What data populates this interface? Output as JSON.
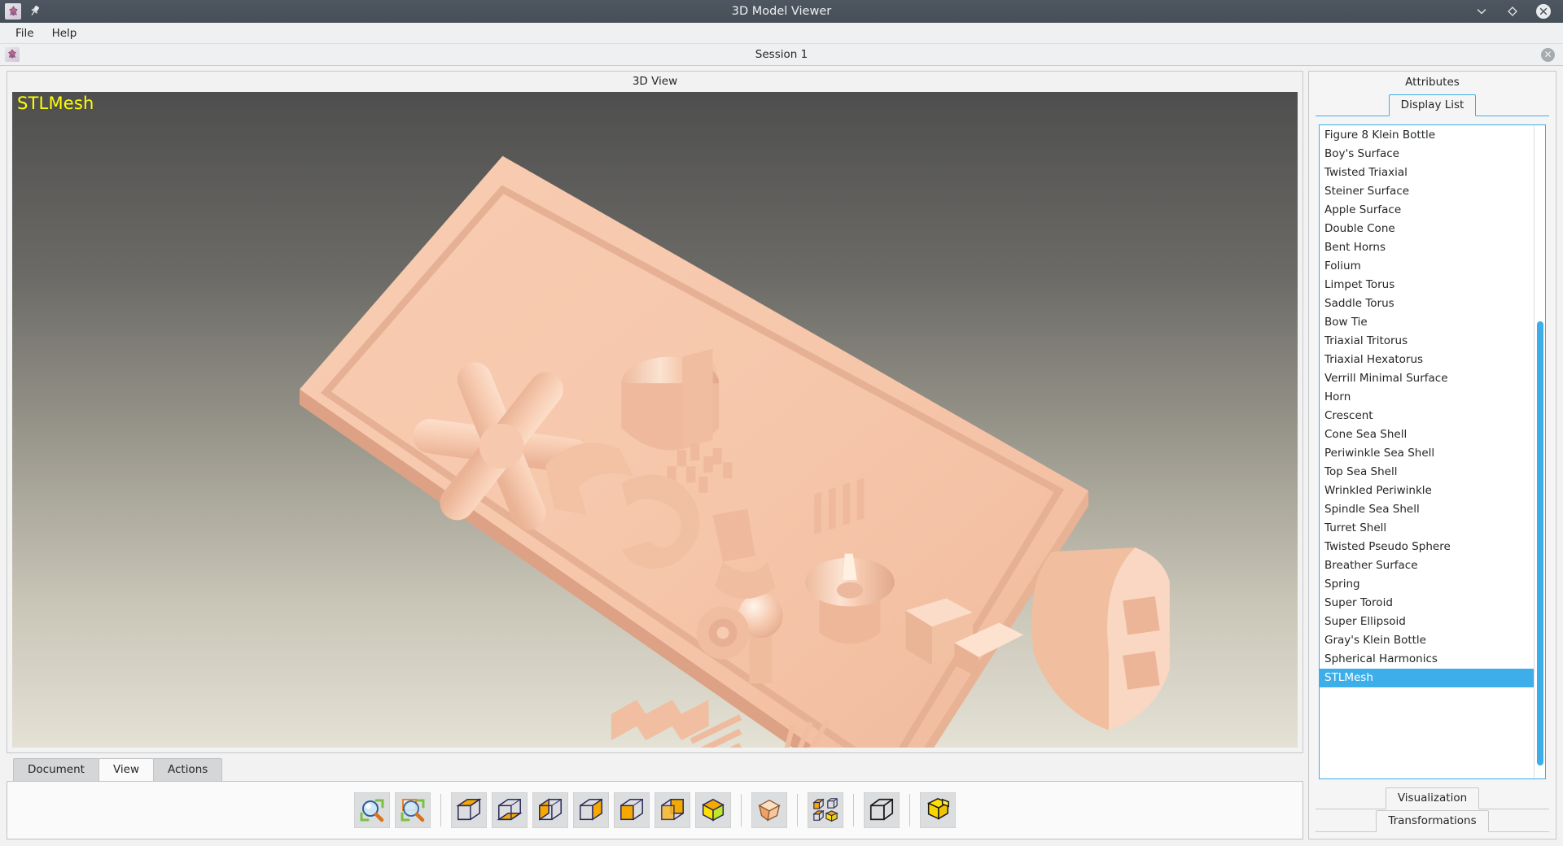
{
  "window": {
    "title": "3D Model Viewer",
    "app_icon": "app-icon",
    "pin_icon": "pin-icon",
    "controls": {
      "minimize": "chevron-down-icon",
      "maximize": "diamond-icon",
      "close": "close-circle-icon"
    }
  },
  "menubar": {
    "items": [
      {
        "label": "File"
      },
      {
        "label": "Help"
      }
    ]
  },
  "session": {
    "title": "Session 1",
    "icon": "session-icon",
    "close_label": "✕"
  },
  "view_panel": {
    "title": "3D View",
    "viewport_label": "STLMesh",
    "label_color": "#ffff00",
    "bg_top_color": "#4e4e4e",
    "bg_bottom_color": "#e4e1d5",
    "model_color": "#f5c3a8"
  },
  "bottom_tabs": {
    "tabs": [
      {
        "label": "Document",
        "active": false
      },
      {
        "label": "View",
        "active": true
      },
      {
        "label": "Actions",
        "active": false
      }
    ]
  },
  "toolbar": {
    "groups": [
      {
        "buttons": [
          {
            "name": "zoom-fit-icon",
            "label": "Fit All"
          },
          {
            "name": "zoom-region-icon",
            "label": "Zoom Region"
          }
        ]
      },
      {
        "buttons": [
          {
            "name": "view-top-icon",
            "label": "Top View"
          },
          {
            "name": "view-bottom-icon",
            "label": "Bottom View"
          },
          {
            "name": "view-left-icon",
            "label": "Left View"
          },
          {
            "name": "view-right-icon",
            "label": "Right View"
          },
          {
            "name": "view-front-icon",
            "label": "Front View"
          },
          {
            "name": "view-back-icon",
            "label": "Back View"
          },
          {
            "name": "view-axonometric-icon",
            "label": "Axonometric View"
          }
        ]
      },
      {
        "buttons": [
          {
            "name": "view-perspective-icon",
            "label": "Perspective"
          }
        ]
      },
      {
        "buttons": [
          {
            "name": "view-quad-grid-icon",
            "label": "Four Views"
          }
        ]
      },
      {
        "buttons": [
          {
            "name": "wireframe-box-icon",
            "label": "Wireframe"
          }
        ]
      },
      {
        "buttons": [
          {
            "name": "shaded-box-icon",
            "label": "Shaded"
          }
        ]
      }
    ]
  },
  "attributes": {
    "title": "Attributes",
    "tab": "Display List",
    "accent_color": "#3daee9",
    "display_list": {
      "items": [
        "Figure 8 Klein Bottle",
        "Boy's Surface",
        "Twisted Triaxial",
        "Steiner Surface",
        "Apple Surface",
        "Double Cone",
        "Bent Horns",
        "Folium",
        "Limpet Torus",
        "Saddle Torus",
        "Bow Tie",
        "Triaxial Tritorus",
        "Triaxial Hexatorus",
        "Verrill Minimal Surface",
        "Horn",
        "Crescent",
        "Cone Sea Shell",
        "Periwinkle Sea Shell",
        "Top Sea Shell",
        "Wrinkled Periwinkle",
        "Spindle Sea Shell",
        "Turret Shell",
        "Twisted Pseudo Sphere",
        "Breather Surface",
        "Spring",
        "Super Toroid",
        "Super Ellipsoid",
        "Gray's Klein Bottle",
        "Spherical Harmonics",
        "STLMesh"
      ],
      "selected": "STLMesh",
      "scroll_thumb_top_pct": 30,
      "scroll_thumb_height_pct": 68
    },
    "bottom_tabs": [
      {
        "label": "Visualization"
      },
      {
        "label": "Transformations"
      }
    ]
  }
}
